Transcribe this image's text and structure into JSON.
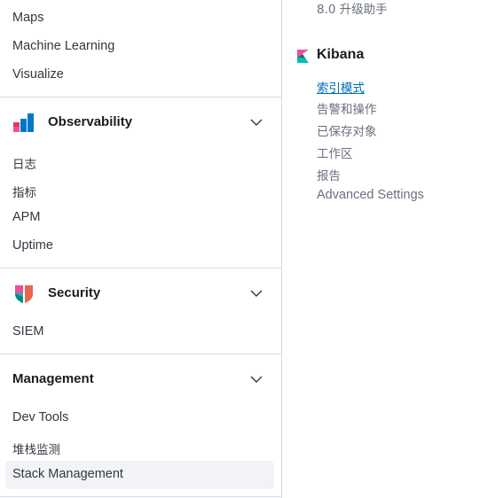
{
  "nav": {
    "top_items": [
      {
        "label": "Maps"
      },
      {
        "label": "Machine Learning"
      },
      {
        "label": "Visualize"
      }
    ],
    "observability": {
      "title": "Observability",
      "icon": "observability-logo-icon",
      "items": [
        {
          "label": "日志"
        },
        {
          "label": "指标"
        },
        {
          "label": "APM"
        },
        {
          "label": "Uptime"
        }
      ]
    },
    "security": {
      "title": "Security",
      "icon": "security-logo-icon",
      "items": [
        {
          "label": "SIEM"
        }
      ]
    },
    "management": {
      "title": "Management",
      "items": [
        {
          "label": "Dev Tools"
        },
        {
          "label": "堆栈监测"
        },
        {
          "label": "Stack Management"
        }
      ]
    }
  },
  "right": {
    "top_item": "8.0 升级助手",
    "kibana": {
      "title": "Kibana",
      "icon": "kibana-logo-icon",
      "items": [
        {
          "label": "索引模式"
        },
        {
          "label": "告警和操作"
        },
        {
          "label": "已保存对象"
        },
        {
          "label": "工作区"
        },
        {
          "label": "报告"
        },
        {
          "label": "Advanced Settings"
        }
      ]
    }
  },
  "colors": {
    "link": "#006bb8",
    "divider": "#d3dae6",
    "active_bg": "#f1f3f6",
    "heading": "#1a1c21",
    "text": "#343741",
    "muted": "#69707d"
  }
}
